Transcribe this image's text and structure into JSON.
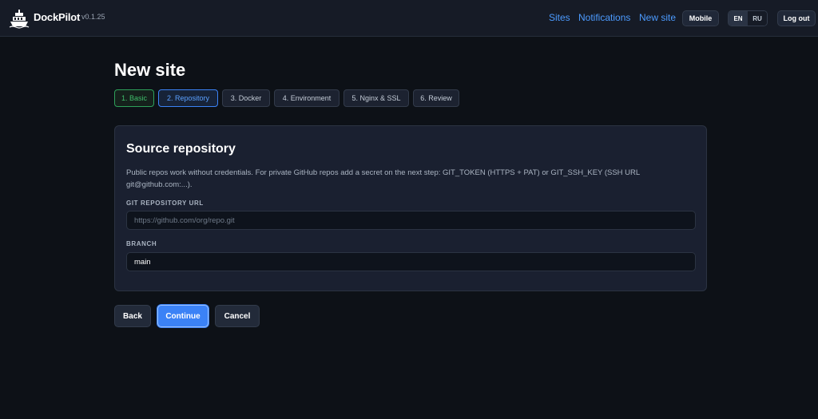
{
  "header": {
    "brand": "DockPilot",
    "version": "v0.1.25",
    "nav": {
      "sites": "Sites",
      "notifications": "Notifications",
      "new_site": "New site"
    },
    "mobile_label": "Mobile",
    "lang_en": "EN",
    "lang_ru": "RU",
    "logout_label": "Log out"
  },
  "page": {
    "title": "New site"
  },
  "steps": [
    {
      "label": "1. Basic",
      "state": "done"
    },
    {
      "label": "2. Repository",
      "state": "current"
    },
    {
      "label": "3. Docker",
      "state": "pending"
    },
    {
      "label": "4. Environment",
      "state": "pending"
    },
    {
      "label": "5. Nginx & SSL",
      "state": "pending"
    },
    {
      "label": "6. Review",
      "state": "pending"
    }
  ],
  "card": {
    "title": "Source repository",
    "description": "Public repos work without credentials. For private GitHub repos add a secret on the next step: GIT_TOKEN (HTTPS + PAT) or GIT_SSH_KEY (SSH URL git@github.com:...).",
    "repo_label": "GIT REPOSITORY URL",
    "repo_value": "",
    "repo_placeholder": "https://github.com/org/repo.git",
    "branch_label": "BRANCH",
    "branch_value": "main",
    "branch_placeholder": ""
  },
  "actions": {
    "back": "Back",
    "continue": "Continue",
    "cancel": "Cancel"
  },
  "colors": {
    "background": "#0d1117",
    "accent": "#3b82f6",
    "link": "#4c9bff",
    "success": "#3fbf6b"
  },
  "icons": {
    "logo": "ship-wheel-icon"
  }
}
